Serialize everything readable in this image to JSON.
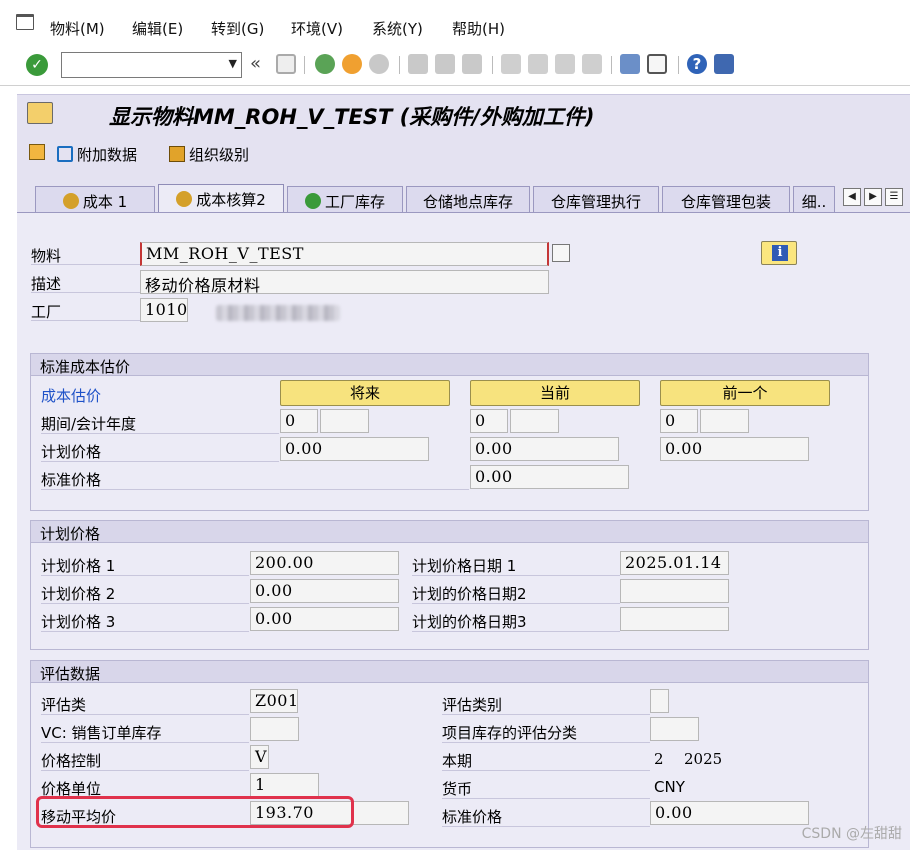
{
  "menu": {
    "items": [
      "物料(M)",
      "编辑(E)",
      "转到(G)",
      "环境(V)",
      "系统(Y)",
      "帮助(H)"
    ]
  },
  "toolbar": {
    "command_value": "",
    "back_glyph": "«"
  },
  "title": {
    "text": "显示物料MM_ROH_V_TEST (采购件/外购加工件)"
  },
  "app_toolbar": {
    "additional_data": "附加数据",
    "org_levels": "组织级别"
  },
  "tabs": {
    "items": [
      "成本 1",
      "成本核算2",
      "工厂库存",
      "仓储地点库存",
      "仓库管理执行",
      "仓库管理包装",
      "细.."
    ],
    "active": "成本核算2"
  },
  "header": {
    "material_label": "物料",
    "material_value": "MM_ROH_V_TEST",
    "desc_label": "描述",
    "desc_value": "移动价格原材料",
    "plant_label": "工厂",
    "plant_value": "1010"
  },
  "std_cost": {
    "title": "标准成本估价",
    "estimate_label": "成本估价",
    "col_future": "将来",
    "col_current": "当前",
    "col_previous": "前一个",
    "period_label": "期间/会计年度",
    "planned_price_label": "计划价格",
    "std_price_label": "标准价格",
    "future_period": "0",
    "current_period": "0",
    "previous_period": "0",
    "future_planned": "0.00",
    "current_planned": "0.00",
    "previous_planned": "0.00",
    "current_std": "0.00"
  },
  "planned": {
    "title": "计划价格",
    "p1_label": "计划价格 1",
    "p1_value": "200.00",
    "p2_label": "计划价格 2",
    "p2_value": "0.00",
    "p3_label": "计划价格 3",
    "p3_value": "0.00",
    "d1_label": "计划价格日期 1",
    "d1_value": "2025.01.14",
    "d2_label": "计划的价格日期2",
    "d2_value": "",
    "d3_label": "计划的价格日期3",
    "d3_value": ""
  },
  "valuation": {
    "title": "评估数据",
    "class_label": "评估类",
    "class_value": "Z001",
    "vc_label": "VC: 销售订单库存",
    "vc_value": "",
    "price_ctrl_label": "价格控制",
    "price_ctrl_value": "V",
    "price_unit_label": "价格单位",
    "price_unit_value": "1",
    "map_label": "移动平均价",
    "map_value": "193.70",
    "category_label": "评估类别",
    "category_value": "",
    "proj_label": "项目库存的评估分类",
    "proj_value": "",
    "period_label": "本期",
    "period_value": "2",
    "year_value": "2025",
    "currency_label": "货币",
    "currency_value": "CNY",
    "std_label": "标准价格",
    "std_value": "0.00"
  },
  "watermark": "CSDN @左甜甜",
  "colors": {
    "content_bg": "#ecebf6",
    "group_head": "#d8d6ea",
    "yellow_button": "#f7e37e",
    "highlight": "#e0324c",
    "link_label": "#1f52c8"
  }
}
